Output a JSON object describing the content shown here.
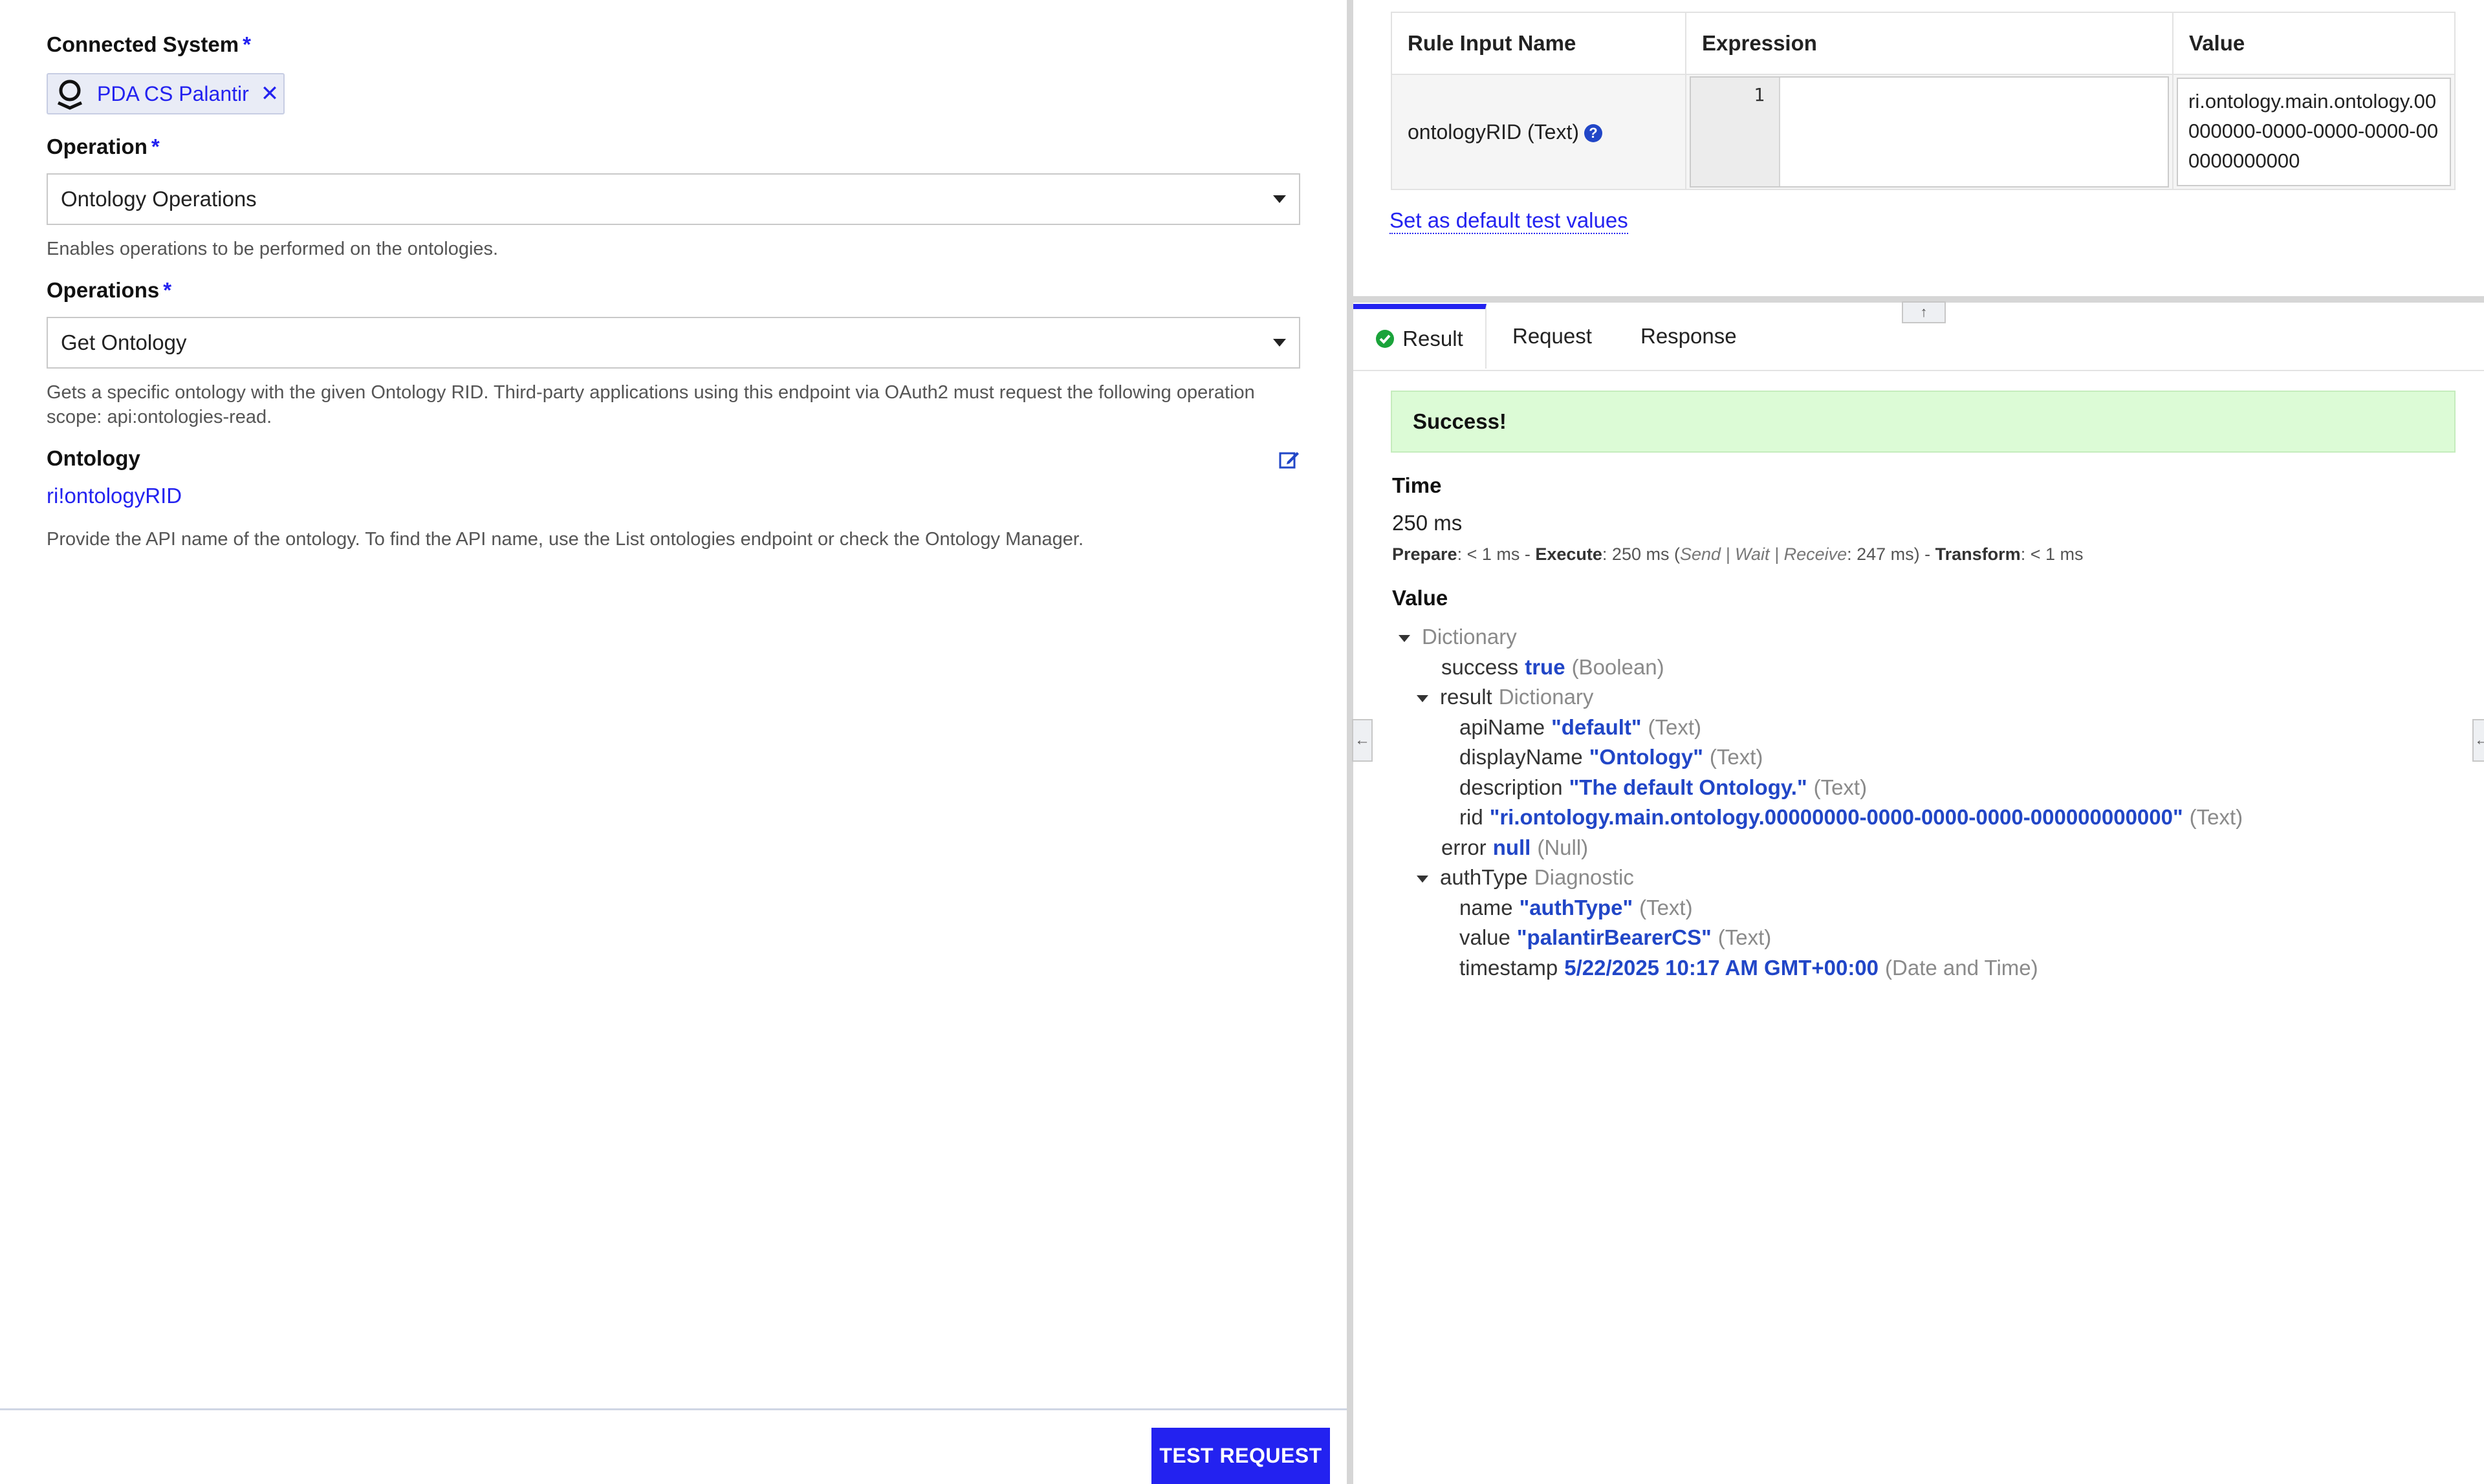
{
  "left": {
    "connected_system": {
      "label": "Connected System",
      "required": "*",
      "chip_text": "PDA CS Palantir",
      "chip_remove": "✕"
    },
    "operation": {
      "label": "Operation",
      "required": "*",
      "value": "Ontology Operations",
      "help": "Enables operations to be performed on the ontologies."
    },
    "operations": {
      "label": "Operations",
      "required": "*",
      "value": "Get Ontology",
      "help": "Gets a specific ontology with the given Ontology RID. Third-party applications using this endpoint via OAuth2 must request the following operation scope: api:ontologies-read."
    },
    "ontology": {
      "label": "Ontology",
      "link": "ri!ontologyRID",
      "help": "Provide the API name of the ontology. To find the API name, use the List ontologies endpoint or check the Ontology Manager."
    },
    "test_button": "TEST REQUEST"
  },
  "rule_inputs": {
    "headers": {
      "name": "Rule Input Name",
      "expression": "Expression",
      "value": "Value"
    },
    "row": {
      "name": "ontologyRID (Text)",
      "help_icon": "?",
      "line_number": "1",
      "value": "ri.ontology.main.ontology.00000000-0000-0000-0000-000000000000"
    },
    "default_link": "Set as default test values"
  },
  "tabs": {
    "result": "Result",
    "request": "Request",
    "response": "Response"
  },
  "result": {
    "banner": "Success!",
    "time_title": "Time",
    "time_value": "250 ms",
    "timing": {
      "prepare_label": "Prepare",
      "prepare_value": ": < 1 ms - ",
      "execute_label": "Execute",
      "execute_value": ": 250 ms (",
      "execute_detail": "Send | Wait | Receive",
      "execute_detail_value": ": 247 ms) - ",
      "transform_label": "Transform",
      "transform_value": ": < 1 ms"
    },
    "value_title": "Value",
    "tree": {
      "root": "Dictionary",
      "success_key": "success",
      "success_val": "true",
      "success_type": "(Boolean)",
      "result_key": "result",
      "result_type": "Dictionary",
      "apiName_key": "apiName",
      "apiName_val": "\"default\"",
      "apiName_type": "(Text)",
      "displayName_key": "displayName",
      "displayName_val": "\"Ontology\"",
      "displayName_type": "(Text)",
      "description_key": "description",
      "description_val": "\"The default Ontology.\"",
      "description_type": "(Text)",
      "rid_key": "rid",
      "rid_val": "\"ri.ontology.main.ontology.00000000-0000-0000-0000-000000000000\"",
      "rid_type": "(Text)",
      "error_key": "error",
      "error_val": "null",
      "error_type": "(Null)",
      "authType_key": "authType",
      "authType_type": "Diagnostic",
      "name_key": "name",
      "name_val": "\"authType\"",
      "name_type": "(Text)",
      "value_key": "value",
      "value_val": "\"palantirBearerCS\"",
      "value_type": "(Text)",
      "timestamp_key": "timestamp",
      "timestamp_val": "5/22/2025 10:17 AM GMT+00:00",
      "timestamp_type": "(Date and Time)"
    }
  },
  "colors": {
    "accent": "#2322f0",
    "value_blue": "#2146c7",
    "success_bg": "#dcfbd6"
  },
  "icons": [
    "palantir-logo-icon",
    "remove-icon",
    "chevron-down-icon",
    "edit-icon",
    "help-icon",
    "check-circle-icon",
    "collapse-left-icon",
    "collapse-up-icon"
  ]
}
